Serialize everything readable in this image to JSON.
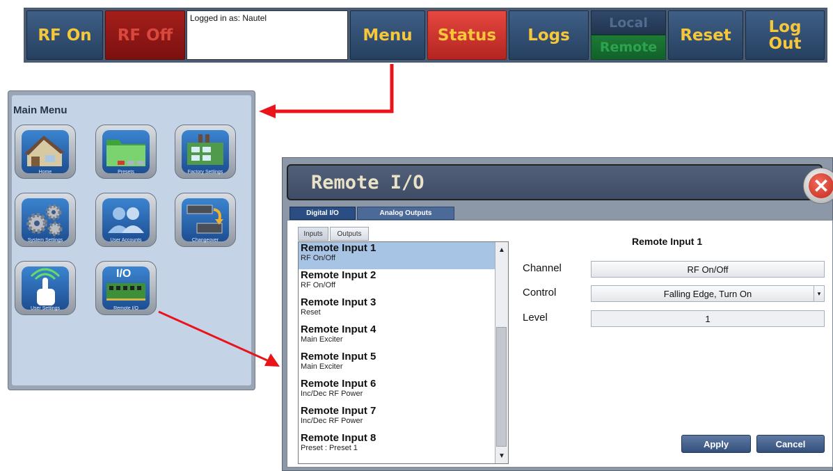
{
  "toolbar": {
    "rf_on": "RF On",
    "rf_off": "RF Off",
    "login_text": "Logged in as: Nautel",
    "menu": "Menu",
    "status": "Status",
    "logs": "Logs",
    "local": "Local",
    "remote": "Remote",
    "reset": "Reset",
    "log_out_line1": "Log",
    "log_out_line2": "Out"
  },
  "main_menu": {
    "title": "Main Menu",
    "items": [
      {
        "label": "Home",
        "icon": "home-icon"
      },
      {
        "label": "Presets",
        "icon": "presets-folder-icon"
      },
      {
        "label": "Factory Settings",
        "icon": "factory-icon"
      },
      {
        "label": "System Settings",
        "icon": "gears-icon"
      },
      {
        "label": "User Accounts",
        "icon": "users-icon"
      },
      {
        "label": "Changeover",
        "icon": "changeover-icon"
      },
      {
        "label": "User Settings",
        "icon": "touch-hand-icon"
      },
      {
        "label": "Remote I/O",
        "icon": "io-card-icon"
      }
    ],
    "io_badge": "I/O"
  },
  "remote_io": {
    "title": "Remote I/O",
    "tabs": [
      "Digital I/O",
      "Analog Outputs"
    ],
    "subtabs": [
      "Inputs",
      "Outputs"
    ],
    "inputs": [
      {
        "name": "Remote Input 1",
        "function": "RF On/Off"
      },
      {
        "name": "Remote Input 2",
        "function": "RF On/Off"
      },
      {
        "name": "Remote Input 3",
        "function": "Reset"
      },
      {
        "name": "Remote Input 4",
        "function": "Main Exciter"
      },
      {
        "name": "Remote Input 5",
        "function": "Main Exciter"
      },
      {
        "name": "Remote Input 6",
        "function": "Inc/Dec RF Power"
      },
      {
        "name": "Remote Input 7",
        "function": "Inc/Dec RF Power"
      },
      {
        "name": "Remote Input 8",
        "function": "Preset : Preset 1"
      }
    ],
    "detail": {
      "heading": "Remote Input 1",
      "channel_label": "Channel",
      "channel_value": "RF On/Off",
      "control_label": "Control",
      "control_value": "Falling Edge, Turn On",
      "level_label": "Level",
      "level_value": "1"
    },
    "apply": "Apply",
    "cancel": "Cancel"
  },
  "colors": {
    "toolbar_text": "#f7c73b",
    "button_blue": "#2f4c70",
    "button_red": "#d23a33",
    "arrow_red": "#e8141a",
    "selected_row": "#a8c4e5"
  }
}
